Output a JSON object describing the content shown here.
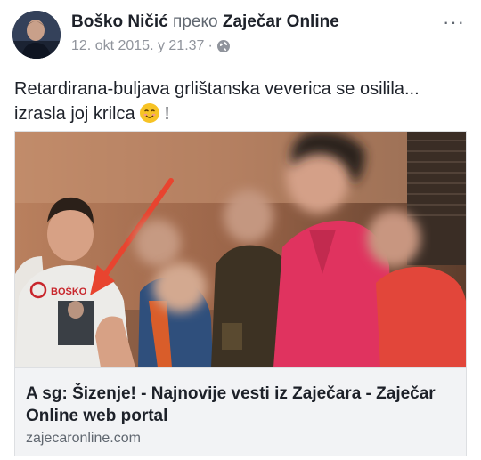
{
  "post": {
    "author": "Boško Ničić",
    "via": "преко",
    "page": "Zaječar Online",
    "date": "12. okt 2015. у 21.37",
    "separator": "·",
    "more": "···",
    "text_line1": "Retardirana-buljava grlištanska veverica se osilila...",
    "text_line2_a": "izrasla joj krilca",
    "text_line2_b": "!",
    "icons": {
      "privacy": "globe-icon",
      "emoji": "smiling-face-icon",
      "menu": "more-options-icon"
    }
  },
  "link": {
    "title": "A sg: Šizenje! - Najnovije vesti iz Zaječara - Zaječar Online web portal",
    "domain": "zajecaronline.com",
    "image_text": "BOŠKO"
  },
  "colors": {
    "text": "#1d2129",
    "secondary": "#606770",
    "meta": "#90949c",
    "card_bg": "#f2f3f5",
    "arrow": "#e8442f",
    "shirt_pink": "#e0335f"
  }
}
